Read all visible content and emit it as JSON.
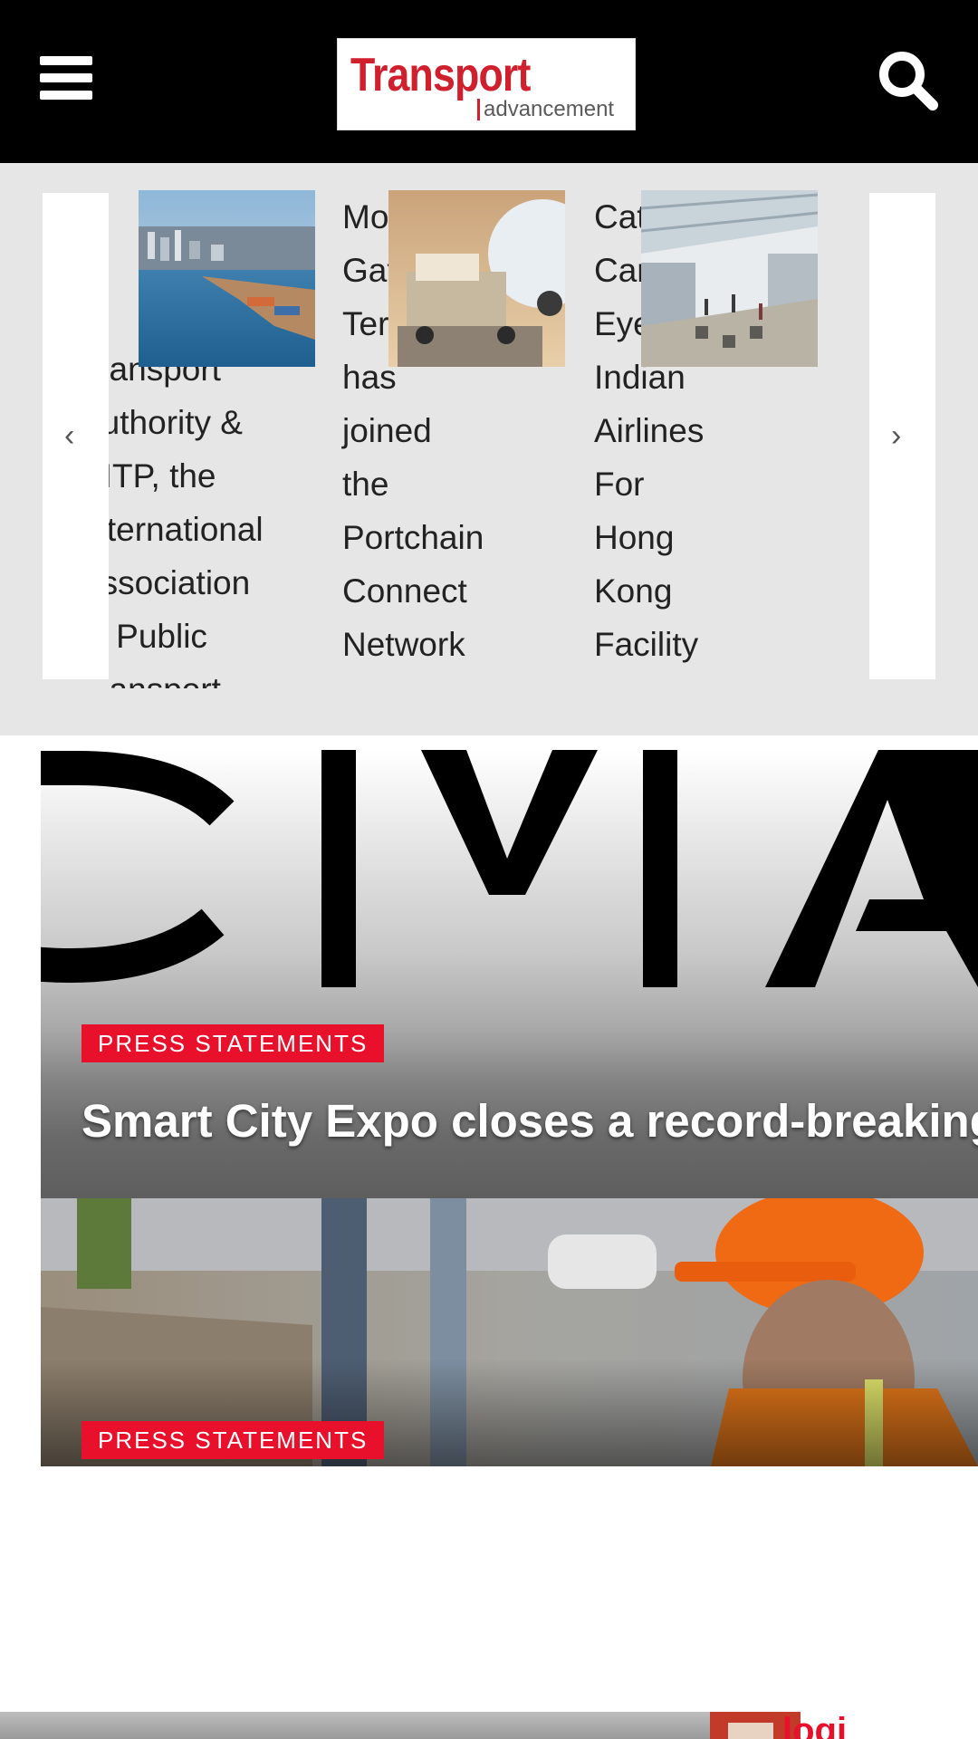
{
  "header": {
    "logo_main": "Transport",
    "logo_sub": "advancement"
  },
  "carousel": {
    "prev_glyph": "‹",
    "next_glyph": "›",
    "slides": [
      {
        "title": "Transport\nAuthority &\nUITP, the\nInternational\nAssociation\nof Public\nTransport"
      },
      {
        "title": "Modern\nGateway\nTerminal\nhas\njoined\nthe\nPortchain\nConnect\nNetwork"
      },
      {
        "title": "Cathay\nCargo\nEyes\nIndian\nAirlines\nFor\nHong\nKong\nFacility"
      }
    ]
  },
  "featured": [
    {
      "badge": "PRESS STATEMENTS",
      "title": "Smart City Expo closes a record-breaking"
    },
    {
      "badge": "PRESS STATEMENTS"
    }
  ],
  "bottom": {
    "peek_text": "logi"
  },
  "colors": {
    "accent": "#e8102a",
    "logo_red": "#d0202e",
    "header_bg": "#000000",
    "carousel_bg": "#e6e6e6"
  },
  "icons": [
    "hamburger-menu-icon",
    "search-icon",
    "chevron-left-icon",
    "chevron-right-icon"
  ]
}
